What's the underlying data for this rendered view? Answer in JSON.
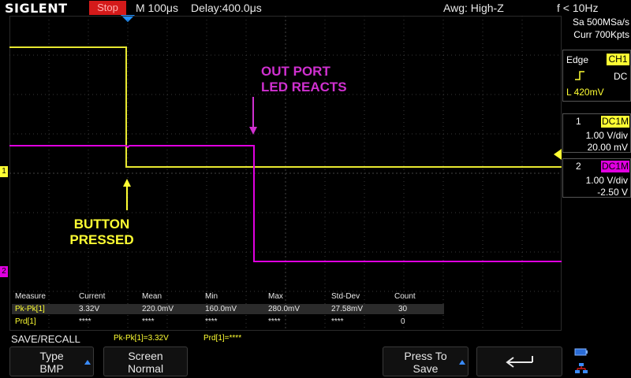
{
  "topbar": {
    "logo": "SIGLENT",
    "run_state": "Stop",
    "timebase": "M 100μs",
    "delay": "Delay:400.0μs",
    "impedance": "Awg: High-Z",
    "frequency": "f < 10Hz"
  },
  "acquisition": {
    "sample_rate": "Sa 500MSa/s",
    "memory": "Curr 700Kpts"
  },
  "trigger": {
    "type": "Edge",
    "source": "CH1",
    "coupling": "DC",
    "level": "L  420mV"
  },
  "channels": [
    {
      "number": "1",
      "coupling": "DC1M",
      "scale": "1.00 V/div",
      "offset": "20.00 mV",
      "color": "#ffff33"
    },
    {
      "number": "2",
      "coupling": "DC1M",
      "scale": "1.00 V/div",
      "offset": "-2.50 V",
      "color": "#e000e0"
    }
  ],
  "annotations": {
    "out_port_line1": "OUT PORT",
    "out_port_line2": "LED REACTS",
    "button_line1": "BUTTON",
    "button_line2": "PRESSED"
  },
  "markers": {
    "ch1": "1",
    "ch2": "2"
  },
  "measure": {
    "headers": [
      "Measure",
      "Current",
      "Mean",
      "Min",
      "Max",
      "Std-Dev",
      "Count"
    ],
    "rows": [
      [
        "Pk-Pk[1]",
        "3.32V",
        "220.0mV",
        "160.0mV",
        "280.0mV",
        "27.58mV",
        "30"
      ],
      [
        "Prd[1]",
        "****",
        "****",
        "****",
        "****",
        "****",
        "0"
      ]
    ]
  },
  "statusbar": {
    "menu_title": "SAVE/RECALL",
    "pkpk": "Pk-Pk[1]=3.32V",
    "prd": "Prd[1]=****"
  },
  "softkeys": {
    "type_label": "Type",
    "type_value": "BMP",
    "screen_label": "Screen",
    "screen_value": "Normal",
    "press_label": "Press To",
    "press_value": "Save"
  },
  "colors": {
    "ch1": "#ffff33",
    "ch2": "#e000e0",
    "stop": "#d41a1a",
    "trigger_marker": "#1e90ff"
  }
}
